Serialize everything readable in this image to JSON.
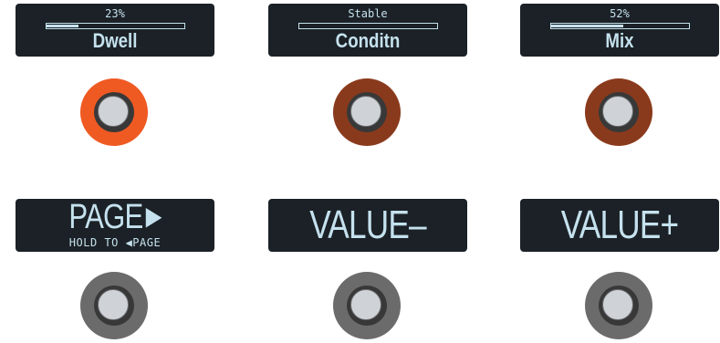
{
  "switches_top": [
    {
      "value_text": "23%",
      "progress": 0.23,
      "param": "Dwell",
      "ring_color": "#ef5a23",
      "show_bar": true
    },
    {
      "value_text": "Stable",
      "progress": 0,
      "param": "Conditn",
      "ring_color": "#8a3a1c",
      "show_bar": true
    },
    {
      "value_text": "52%",
      "progress": 0.52,
      "param": "Mix",
      "ring_color": "#8a3a1c",
      "show_bar": true
    }
  ],
  "switches_bottom": [
    {
      "label": "PAGE",
      "arrow": "▶",
      "sub_label": "HOLD TO ◀PAGE",
      "ring_color": "#6b6b6b"
    },
    {
      "label": "VALUE–",
      "ring_color": "#6b6b6b"
    },
    {
      "label": "VALUE+",
      "ring_color": "#6b6b6b"
    }
  ]
}
